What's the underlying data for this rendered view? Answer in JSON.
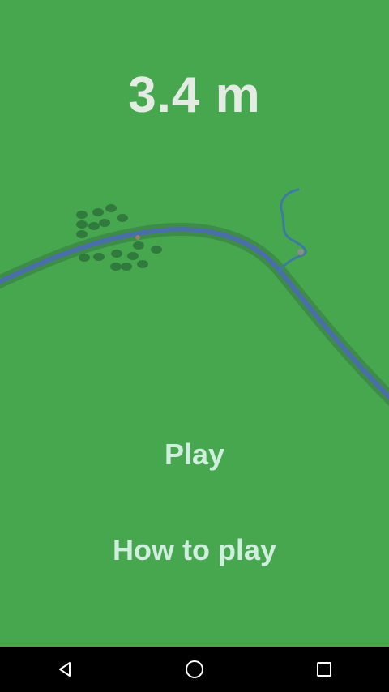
{
  "game": {
    "distance": "3.4 m"
  },
  "menu": {
    "play_label": "Play",
    "how_to_play_label": "How to play"
  },
  "colors": {
    "background": "#47a74f",
    "river": "#4a6fa8",
    "river_bank": "#3d8c47",
    "trees": "#2f7a3c",
    "text_primary": "#e3ece2",
    "text_menu": "#cfeedd",
    "nav_bar": "#000000"
  },
  "nav": {
    "back_icon": "back-triangle-icon",
    "home_icon": "home-circle-icon",
    "recents_icon": "recents-square-icon"
  }
}
